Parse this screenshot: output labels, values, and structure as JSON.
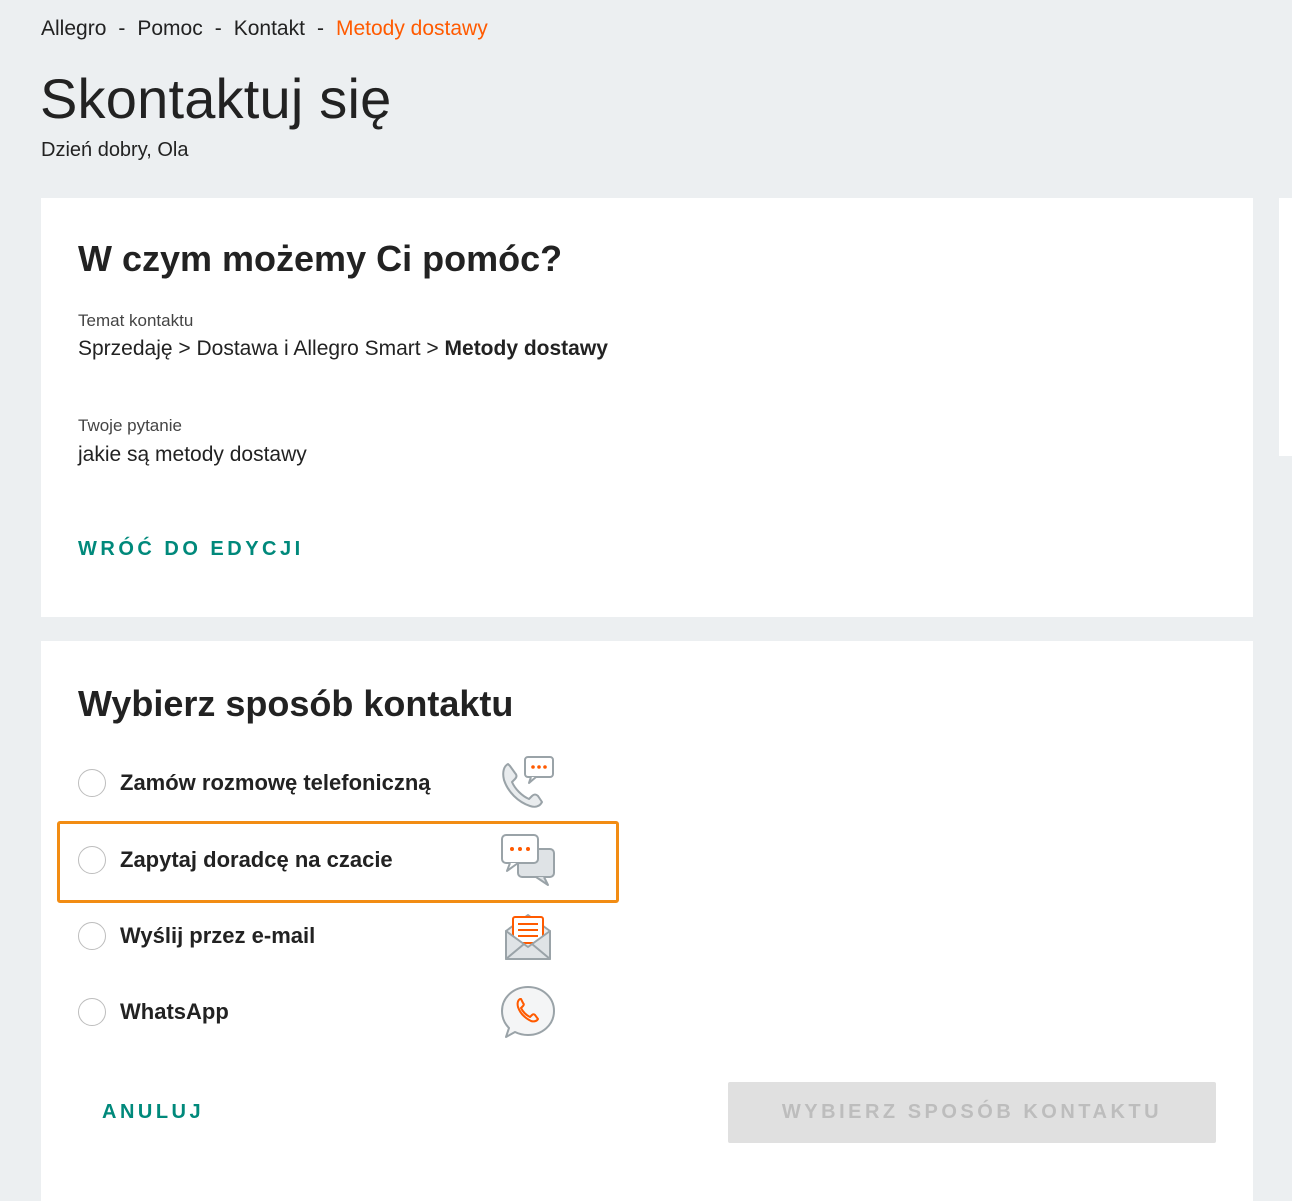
{
  "breadcrumb": {
    "items": [
      "Allegro",
      "Pomoc",
      "Kontakt"
    ],
    "separator": "-",
    "current": "Metody dostawy"
  },
  "header": {
    "title": "Skontaktuj się",
    "greeting": "Dzień dobry, Ola"
  },
  "help_card": {
    "heading": "W czym możemy Ci pomóc?",
    "topic_label": "Temat kontaktu",
    "topic_path": "Sprzedaję > Dostawa i Allegro Smart > ",
    "topic_current": "Metody dostawy",
    "question_label": "Twoje pytanie",
    "question_value": "jakie są metody dostawy",
    "edit_link": "WRÓĆ DO EDYCJI"
  },
  "contact_card": {
    "heading": "Wybierz sposób kontaktu",
    "options": [
      {
        "label": "Zamów rozmowę telefoniczną",
        "icon": "phone-callback-icon"
      },
      {
        "label": "Zapytaj doradcę na czacie",
        "icon": "chat-bubbles-icon"
      },
      {
        "label": "Wyślij przez e-mail",
        "icon": "envelope-icon"
      },
      {
        "label": "WhatsApp",
        "icon": "whatsapp-icon"
      }
    ],
    "cancel_label": "ANULUJ",
    "submit_label": "WYBIERZ SPOSÓB KONTAKTU"
  },
  "colors": {
    "accent_orange": "#ff5a00",
    "link_teal": "#00897b",
    "highlight_border": "#f28c13",
    "background": "#eceff1"
  }
}
